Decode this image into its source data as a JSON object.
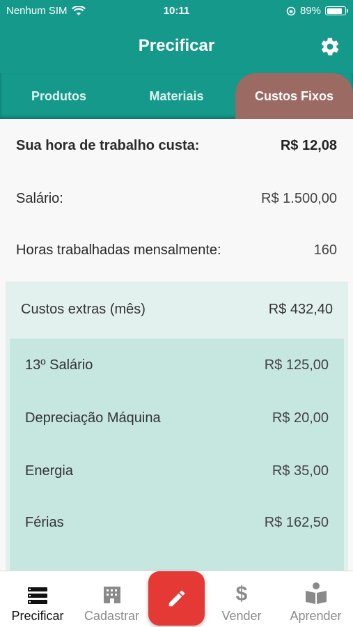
{
  "status_bar": {
    "carrier": "Nenhum SIM",
    "time": "10:11",
    "battery": "89%"
  },
  "app_bar": {
    "title": "Precificar",
    "settings_icon": "gear-icon"
  },
  "tabs": [
    {
      "label": "Produtos",
      "selected": false
    },
    {
      "label": "Materiais",
      "selected": false
    },
    {
      "label": "Custos Fixos",
      "selected": true
    }
  ],
  "summary": {
    "label": "Sua hora de trabalho custa:",
    "value": "R$ 12,08"
  },
  "salary": {
    "label": "Salário:",
    "value": "R$ 1.500,00"
  },
  "hours": {
    "label": "Horas trabalhadas mensalmente:",
    "value": "160"
  },
  "extras": {
    "label": "Custos extras (mês)",
    "value": "R$ 432,40",
    "items": [
      {
        "label": "13º Salário",
        "value": "R$ 125,00"
      },
      {
        "label": "Depreciação Máquina",
        "value": "R$ 20,00"
      },
      {
        "label": "Energia",
        "value": "R$ 35,00"
      },
      {
        "label": "Férias",
        "value": "R$ 162,50"
      }
    ]
  },
  "bottom_nav": [
    {
      "label": "Precificar",
      "icon": "list-icon",
      "active": true
    },
    {
      "label": "Cadastrar",
      "icon": "building-icon",
      "active": false
    },
    {
      "label": "Vender",
      "icon": "dollar-icon",
      "active": false
    },
    {
      "label": "Aprender",
      "icon": "book-reader-icon",
      "active": false
    }
  ],
  "fab": {
    "icon": "pencil-icon",
    "color": "#e53935"
  },
  "colors": {
    "primary": "#15998a",
    "selected_tab": "#9b6a62",
    "extras_bg": "#e3f1ee",
    "extras_list_bg": "#c6e6e0"
  }
}
